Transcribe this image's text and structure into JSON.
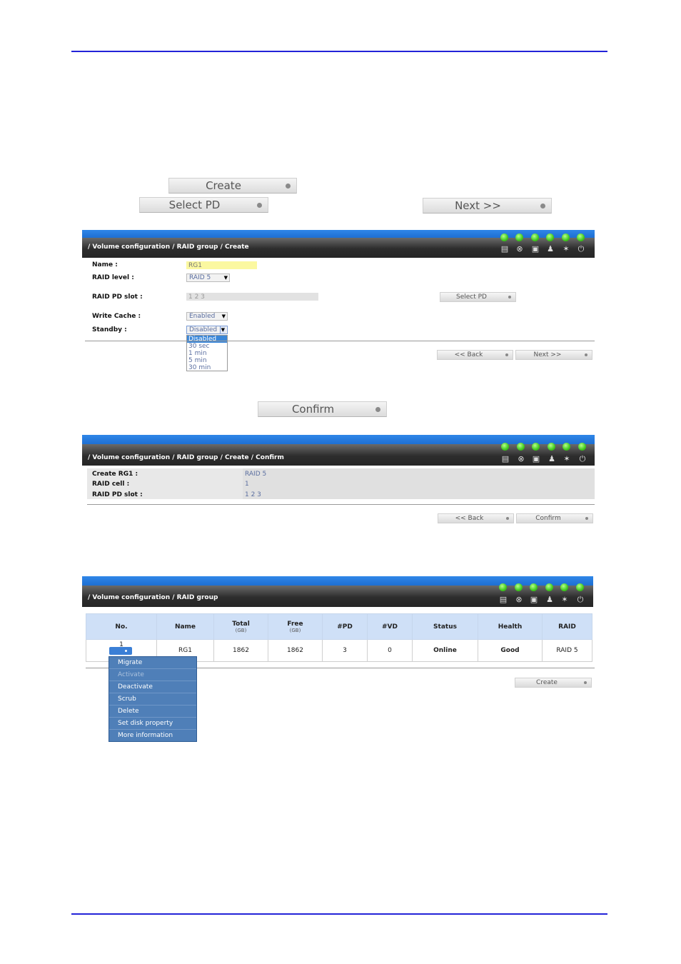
{
  "top_buttons": {
    "create": "Create",
    "select_pd": "Select PD",
    "next": "Next >>",
    "confirm": "Confirm"
  },
  "status_leds": [
    "on",
    "on",
    "on",
    "on",
    "on",
    "on"
  ],
  "status_icons": [
    "disk-icon",
    "thermometer-icon",
    "battery-icon",
    "fan-person-icon",
    "fan-icon",
    "power-icon"
  ],
  "panel1": {
    "path": "/ Volume configuration / RAID group / Create",
    "name_label": "Name :",
    "name_value": "RG1",
    "raid_level_label": "RAID level :",
    "raid_level_value": "RAID 5",
    "pd_slot_label": "RAID PD slot :",
    "pd_slot_value": "1 2 3",
    "select_pd_btn": "Select PD",
    "write_cache_label": "Write Cache :",
    "write_cache_value": "Enabled",
    "standby_label": "Standby :",
    "standby_value": "Disabled",
    "standby_options": [
      "Disabled",
      "30 sec",
      "1 min",
      "5 min",
      "30 min"
    ],
    "back_btn": "<< Back",
    "next_btn": "Next >>"
  },
  "panel2": {
    "path": "/ Volume configuration / RAID group / Create / Confirm",
    "rows": [
      {
        "label": "Create RG1 :",
        "value": "RAID 5"
      },
      {
        "label": "RAID cell :",
        "value": "1"
      },
      {
        "label": "RAID PD slot :",
        "value": "1 2 3"
      }
    ],
    "back_btn": "<< Back",
    "confirm_btn": "Confirm"
  },
  "panel3": {
    "path": "/ Volume configuration / RAID group",
    "headers": [
      "No.",
      "Name",
      "Total",
      "Free",
      "#PD",
      "#VD",
      "Status",
      "Health",
      "RAID"
    ],
    "header_units": {
      "total": "(GB)",
      "free": "(GB)"
    },
    "row": {
      "no": "1",
      "name": "RG1",
      "total": "1862",
      "free": "1862",
      "pd": "3",
      "vd": "0",
      "status": "Online",
      "health": "Good",
      "raid": "RAID 5"
    },
    "menu": [
      "Migrate",
      "Activate",
      "Deactivate",
      "Scrub",
      "Delete",
      "Set disk property",
      "More information"
    ],
    "create_btn": "Create"
  },
  "colors": {
    "rule": "#2323d8",
    "header_blue": "#1e6fd2",
    "menu_bg": "#4f7fb8",
    "status_green": "#2e9a2e"
  }
}
